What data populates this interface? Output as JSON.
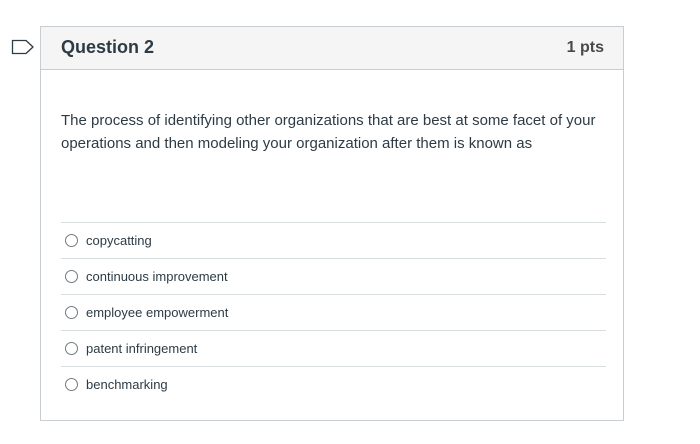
{
  "question": {
    "title": "Question 2",
    "points": "1 pts",
    "text": "The process of identifying other organizations that are best at some facet of your operations and then modeling your organization after them is known as",
    "answers": [
      {
        "label": "copycatting",
        "selected": false
      },
      {
        "label": "continuous improvement",
        "selected": false
      },
      {
        "label": "employee empowerment",
        "selected": false
      },
      {
        "label": "patent infringement",
        "selected": false
      },
      {
        "label": "benchmarking",
        "selected": false
      }
    ]
  },
  "icons": {
    "flag": "flag-question-icon"
  },
  "colors": {
    "header_bg": "#f5f5f5",
    "border": "#c7cdd1",
    "text": "#2d3b45"
  }
}
